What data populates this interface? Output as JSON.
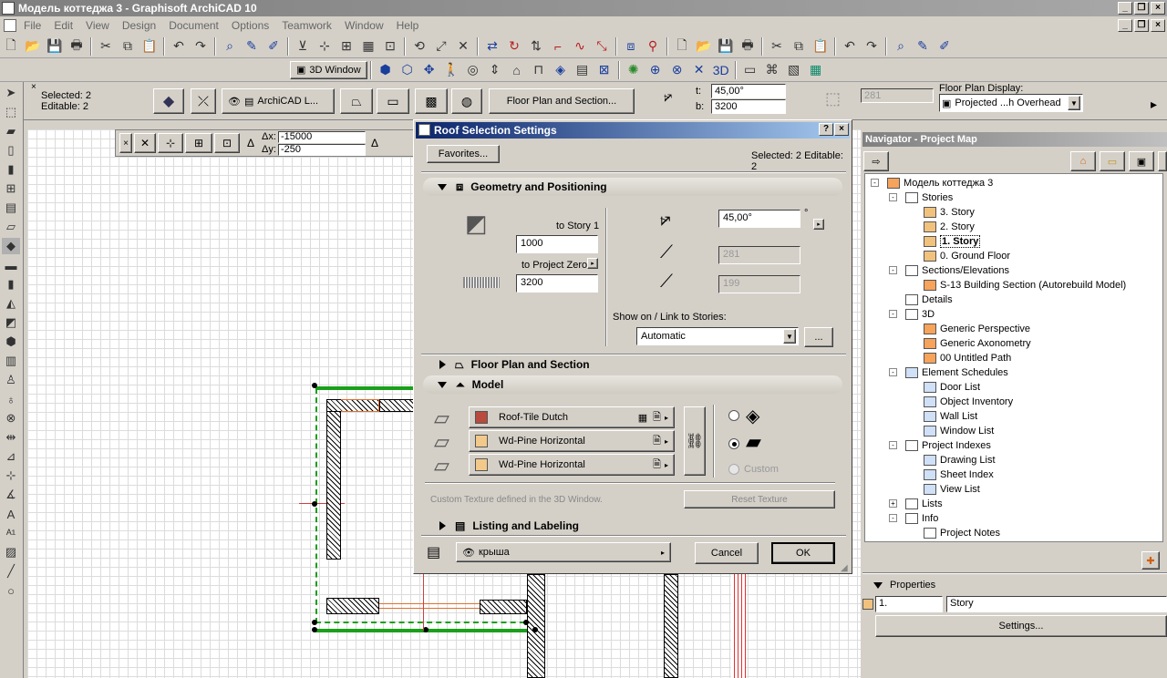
{
  "window": {
    "title": "Модель коттеджа 3 - Graphisoft ArchiCAD 10"
  },
  "menu": [
    "File",
    "Edit",
    "View",
    "Design",
    "Document",
    "Options",
    "Teamwork",
    "Window",
    "Help"
  ],
  "toolbar2": {
    "window3d_label": "3D Window"
  },
  "infobox": {
    "selected": "Selected: 2",
    "editable": "Editable: 2",
    "layer": "ArchiCAD L...",
    "floorplan_btn": "Floor Plan and Section...",
    "angle_label": "t:",
    "angle_value": "45,00°",
    "b_label": "b:",
    "b_value": "3200",
    "disabled_value": "281",
    "fpd_label": "Floor Plan Display:",
    "fpd_value": "Projected ...h Overhead"
  },
  "coords": {
    "dx_label": "Δx:",
    "dx_value": "-15000",
    "dy_label": "Δy:",
    "dy_value": "-250"
  },
  "dialog": {
    "title": "Roof Selection Settings",
    "favorites": "Favorites...",
    "status": "Selected: 2 Editable: 2",
    "geometry": {
      "title": "Geometry and Positioning",
      "to_story_label": "to Story 1",
      "story_offset": "1000",
      "to_zero_label": "to Project Zero",
      "zero_offset": "3200",
      "angle": "45,00°",
      "angle_unit": "°",
      "val2": "281",
      "val3": "199",
      "show_on_label": "Show on / Link to Stories:",
      "show_on_value": "Automatic",
      "more": "..."
    },
    "floorplan_section": "Floor Plan and Section",
    "model": {
      "title": "Model",
      "materials": [
        {
          "name": "Roof-Tile Dutch",
          "color": "#b84a3e"
        },
        {
          "name": "Wd-Pine Horizontal",
          "color": "#f2c98a"
        },
        {
          "name": "Wd-Pine Horizontal",
          "color": "#f2c98a"
        }
      ],
      "custom_label": "Custom",
      "texture_note": "Custom Texture defined in the 3D Window.",
      "reset_texture": "Reset Texture"
    },
    "listing": "Listing and Labeling",
    "layer_value": "крыша",
    "cancel": "Cancel",
    "ok": "OK"
  },
  "navigator": {
    "title": "Navigator - Project Map",
    "tree": [
      {
        "label": "Модель коттеджа 3",
        "depth": 0,
        "icon": "house",
        "pm": "-"
      },
      {
        "label": "Stories",
        "depth": 1,
        "icon": "doc",
        "pm": "-"
      },
      {
        "label": "3. Story",
        "depth": 2,
        "icon": "fold"
      },
      {
        "label": "2. Story",
        "depth": 2,
        "icon": "fold"
      },
      {
        "label": "1. Story",
        "depth": 2,
        "icon": "fold",
        "active": true
      },
      {
        "label": "0. Ground Floor",
        "depth": 2,
        "icon": "fold"
      },
      {
        "label": "Sections/Elevations",
        "depth": 1,
        "icon": "doc",
        "pm": "-"
      },
      {
        "label": "S-13 Building Section (Autorebuild Model)",
        "depth": 2,
        "icon": "house"
      },
      {
        "label": "Details",
        "depth": 1,
        "icon": "doc"
      },
      {
        "label": "3D",
        "depth": 1,
        "icon": "doc",
        "pm": "-"
      },
      {
        "label": "Generic Perspective",
        "depth": 2,
        "icon": "house"
      },
      {
        "label": "Generic Axonometry",
        "depth": 2,
        "icon": "house"
      },
      {
        "label": "00 Untitled Path",
        "depth": 2,
        "icon": "house"
      },
      {
        "label": "Element Schedules",
        "depth": 1,
        "icon": "sched",
        "pm": "-"
      },
      {
        "label": "Door List",
        "depth": 2,
        "icon": "sched"
      },
      {
        "label": "Object Inventory",
        "depth": 2,
        "icon": "sched"
      },
      {
        "label": "Wall List",
        "depth": 2,
        "icon": "sched"
      },
      {
        "label": "Window List",
        "depth": 2,
        "icon": "sched"
      },
      {
        "label": "Project Indexes",
        "depth": 1,
        "icon": "doc",
        "pm": "-"
      },
      {
        "label": "Drawing List",
        "depth": 2,
        "icon": "sched"
      },
      {
        "label": "Sheet Index",
        "depth": 2,
        "icon": "sched"
      },
      {
        "label": "View List",
        "depth": 2,
        "icon": "sched"
      },
      {
        "label": "Lists",
        "depth": 1,
        "icon": "doc",
        "pm": "+"
      },
      {
        "label": "Info",
        "depth": 1,
        "icon": "doc",
        "pm": "-"
      },
      {
        "label": "Project Notes",
        "depth": 2,
        "icon": "doc"
      }
    ],
    "properties_title": "Properties",
    "prop_num": "1.",
    "prop_name": "Story",
    "settings": "Settings..."
  }
}
